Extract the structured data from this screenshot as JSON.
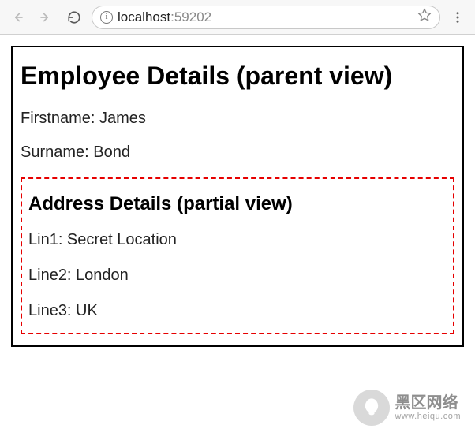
{
  "browser": {
    "url_host": "localhost",
    "url_port": ":59202",
    "info_glyph": "i"
  },
  "page": {
    "parent_title": "Employee Details (parent view)",
    "firstname_line": "Firstname: James",
    "surname_line": "Surname: Bond",
    "partial_title": "Address Details (partial view)",
    "line1": "Lin1: Secret Location",
    "line2": "Line2: London",
    "line3": "Line3: UK"
  },
  "watermark": {
    "cn": "黑区网络",
    "url": "www.heiqu.com"
  }
}
